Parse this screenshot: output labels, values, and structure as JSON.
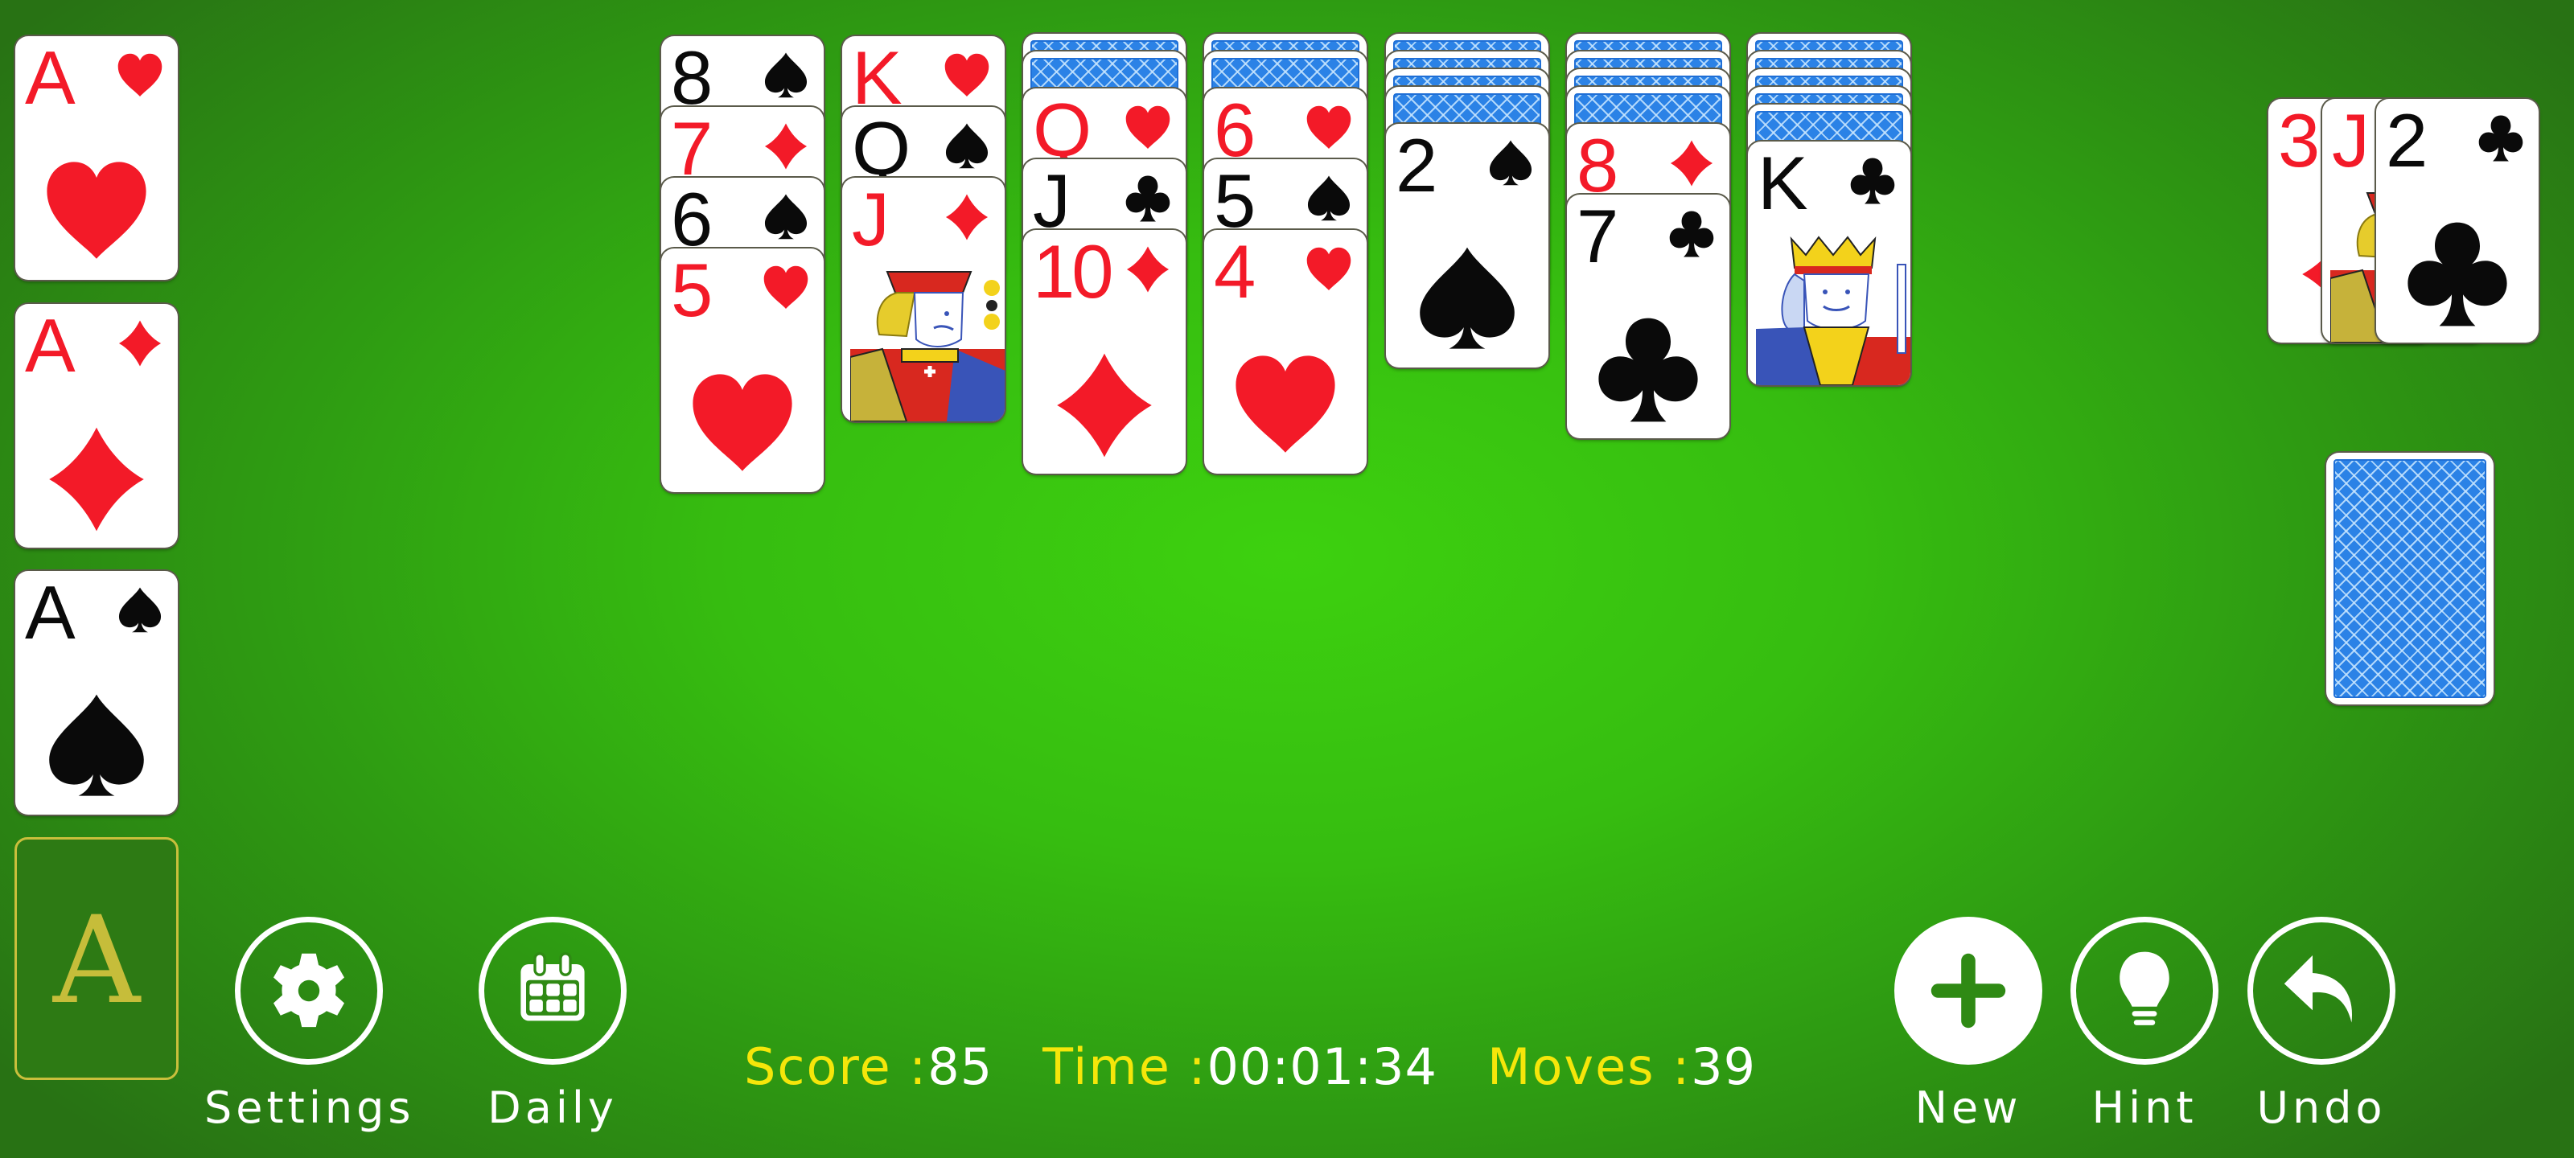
{
  "game": "Klondike Solitaire",
  "colors": {
    "red_suit": "#f31a28",
    "black_suit": "#0a0a0a",
    "label_yellow": "#f5e60a",
    "value_white": "#ffffff",
    "slot_gold": "#c9bf3c",
    "card_back_blue": "#2b82e6",
    "felt_center": "#3dd10f",
    "felt_edge": "#287214"
  },
  "suit_symbols": {
    "hearts": "♥",
    "diamonds": "♦",
    "spades": "♠",
    "clubs": "♣"
  },
  "foundations": [
    {
      "rank": "A",
      "suit": "hearts"
    },
    {
      "rank": "A",
      "suit": "diamonds"
    },
    {
      "rank": "A",
      "suit": "spades"
    },
    {
      "empty": true,
      "placeholder": "A"
    }
  ],
  "tableau": [
    {
      "face_down": 0,
      "face_up": [
        {
          "rank": "8",
          "suit": "spades"
        },
        {
          "rank": "7",
          "suit": "diamonds"
        },
        {
          "rank": "6",
          "suit": "spades"
        },
        {
          "rank": "5",
          "suit": "hearts"
        }
      ]
    },
    {
      "face_down": 0,
      "face_up": [
        {
          "rank": "K",
          "suit": "hearts"
        },
        {
          "rank": "Q",
          "suit": "spades"
        },
        {
          "rank": "J",
          "suit": "diamonds"
        }
      ]
    },
    {
      "face_down": 2,
      "face_up": [
        {
          "rank": "Q",
          "suit": "hearts"
        },
        {
          "rank": "J",
          "suit": "clubs"
        },
        {
          "rank": "10",
          "suit": "diamonds"
        }
      ]
    },
    {
      "face_down": 2,
      "face_up": [
        {
          "rank": "6",
          "suit": "hearts"
        },
        {
          "rank": "5",
          "suit": "spades"
        },
        {
          "rank": "4",
          "suit": "hearts"
        }
      ]
    },
    {
      "face_down": 4,
      "face_up": [
        {
          "rank": "2",
          "suit": "spades"
        }
      ]
    },
    {
      "face_down": 4,
      "face_up": [
        {
          "rank": "8",
          "suit": "diamonds"
        },
        {
          "rank": "7",
          "suit": "clubs"
        }
      ]
    },
    {
      "face_down": 5,
      "face_up": [
        {
          "rank": "K",
          "suit": "clubs"
        }
      ]
    }
  ],
  "waste": [
    {
      "rank": "3",
      "suit": "diamonds"
    },
    {
      "rank": "J",
      "suit": "unknown-red"
    },
    {
      "rank": "2",
      "suit": "clubs"
    }
  ],
  "stock": {
    "has_cards": true
  },
  "toolbar_left": [
    {
      "id": "settings",
      "label": "Settings",
      "icon": "gear-icon"
    },
    {
      "id": "daily",
      "label": "Daily",
      "icon": "calendar-icon"
    }
  ],
  "toolbar_right": [
    {
      "id": "new",
      "label": "New",
      "icon": "plus-icon"
    },
    {
      "id": "hint",
      "label": "Hint",
      "icon": "lightbulb-icon"
    },
    {
      "id": "undo",
      "label": "Undo",
      "icon": "undo-arrow-icon"
    }
  ],
  "status": {
    "score_label": "Score :",
    "score": "85",
    "time_label": "Time :",
    "time": "00:01:34",
    "moves_label": "Moves :",
    "moves": "39"
  }
}
